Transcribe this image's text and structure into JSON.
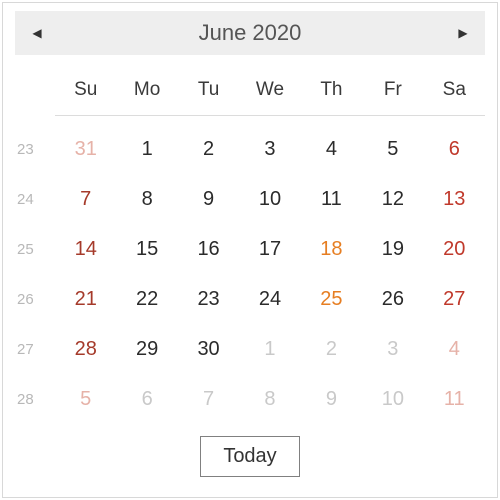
{
  "header": {
    "prev_icon": "◀",
    "next_icon": "▶",
    "title": "June 2020"
  },
  "day_headers": [
    "Su",
    "Mo",
    "Tu",
    "We",
    "Th",
    "Fr",
    "Sa"
  ],
  "weeks": [
    {
      "num": "23",
      "days": [
        {
          "n": "31",
          "cls": "other sunday"
        },
        {
          "n": "1",
          "cls": ""
        },
        {
          "n": "2",
          "cls": ""
        },
        {
          "n": "3",
          "cls": ""
        },
        {
          "n": "4",
          "cls": ""
        },
        {
          "n": "5",
          "cls": ""
        },
        {
          "n": "6",
          "cls": "saturday"
        }
      ]
    },
    {
      "num": "24",
      "days": [
        {
          "n": "7",
          "cls": "sunday"
        },
        {
          "n": "8",
          "cls": ""
        },
        {
          "n": "9",
          "cls": ""
        },
        {
          "n": "10",
          "cls": ""
        },
        {
          "n": "11",
          "cls": ""
        },
        {
          "n": "12",
          "cls": ""
        },
        {
          "n": "13",
          "cls": "saturday"
        }
      ]
    },
    {
      "num": "25",
      "days": [
        {
          "n": "14",
          "cls": "sunday"
        },
        {
          "n": "15",
          "cls": ""
        },
        {
          "n": "16",
          "cls": ""
        },
        {
          "n": "17",
          "cls": ""
        },
        {
          "n": "18",
          "cls": "holiday"
        },
        {
          "n": "19",
          "cls": ""
        },
        {
          "n": "20",
          "cls": "saturday"
        }
      ]
    },
    {
      "num": "26",
      "days": [
        {
          "n": "21",
          "cls": "sunday"
        },
        {
          "n": "22",
          "cls": ""
        },
        {
          "n": "23",
          "cls": ""
        },
        {
          "n": "24",
          "cls": ""
        },
        {
          "n": "25",
          "cls": "holiday"
        },
        {
          "n": "26",
          "cls": ""
        },
        {
          "n": "27",
          "cls": "saturday"
        }
      ]
    },
    {
      "num": "27",
      "days": [
        {
          "n": "28",
          "cls": "sunday"
        },
        {
          "n": "29",
          "cls": ""
        },
        {
          "n": "30",
          "cls": ""
        },
        {
          "n": "1",
          "cls": "other"
        },
        {
          "n": "2",
          "cls": "other"
        },
        {
          "n": "3",
          "cls": "other"
        },
        {
          "n": "4",
          "cls": "other saturday"
        }
      ]
    },
    {
      "num": "28",
      "days": [
        {
          "n": "5",
          "cls": "other sunday"
        },
        {
          "n": "6",
          "cls": "other"
        },
        {
          "n": "7",
          "cls": "other"
        },
        {
          "n": "8",
          "cls": "other"
        },
        {
          "n": "9",
          "cls": "other"
        },
        {
          "n": "10",
          "cls": "other"
        },
        {
          "n": "11",
          "cls": "other saturday"
        }
      ]
    }
  ],
  "today_label": "Today"
}
